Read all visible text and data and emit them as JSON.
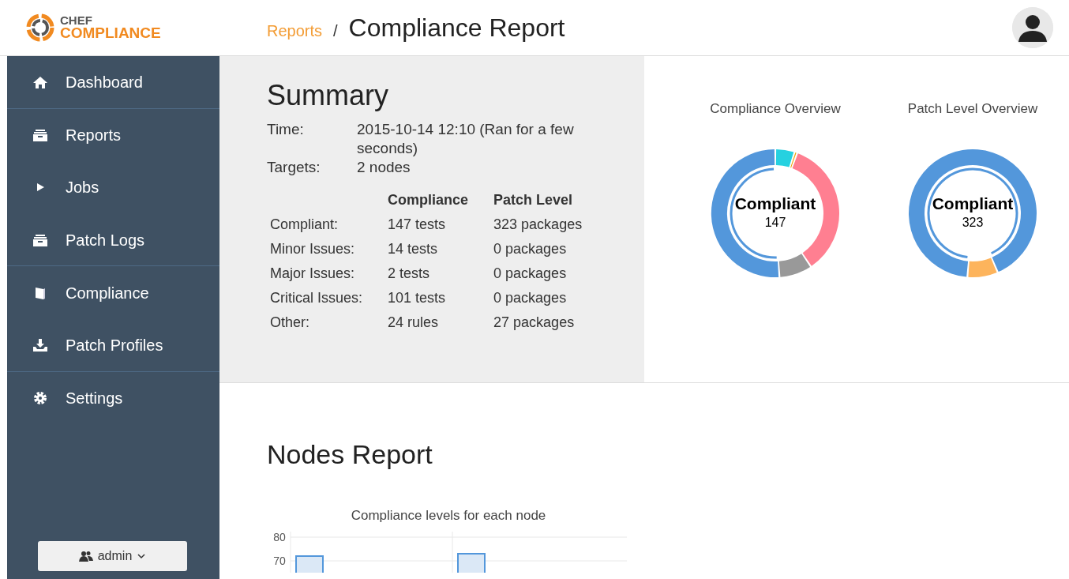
{
  "brand": {
    "top": "CHEF",
    "bottom": "COMPLIANCE"
  },
  "breadcrumb": {
    "parent": "Reports",
    "separator": "/",
    "current": "Compliance Report"
  },
  "sidebar": {
    "items": [
      {
        "label": "Dashboard"
      },
      {
        "label": "Reports"
      },
      {
        "label": "Jobs"
      },
      {
        "label": "Patch Logs"
      },
      {
        "label": "Compliance"
      },
      {
        "label": "Patch Profiles"
      },
      {
        "label": "Settings"
      }
    ],
    "user_button": "admin"
  },
  "summary": {
    "title": "Summary",
    "facts": [
      {
        "label": "Time:",
        "value": "2015-10-14 12:10 (Ran for a few seconds)"
      },
      {
        "label": "Targets:",
        "value": "2 nodes"
      }
    ],
    "columns": [
      "Compliance",
      "Patch Level"
    ],
    "rows": [
      {
        "label": "Compliant:",
        "compliance": "147 tests",
        "patch": "323 packages"
      },
      {
        "label": "Minor Issues:",
        "compliance": "14 tests",
        "patch": "0 packages"
      },
      {
        "label": "Major Issues:",
        "compliance": "2 tests",
        "patch": "0 packages"
      },
      {
        "label": "Critical Issues:",
        "compliance": "101 tests",
        "patch": "0 packages"
      },
      {
        "label": "Other:",
        "compliance": "24 rules",
        "patch": "27 packages"
      }
    ]
  },
  "overviews": [
    {
      "title": "Compliance Overview",
      "center_label": "Compliant",
      "center_value": "147",
      "chart_data": {
        "type": "donut",
        "series": [
          {
            "values": [
              51.04,
              4.86,
              0.69,
              35.07,
              8.34
            ]
          }
        ],
        "colors": [
          "#5397db",
          "#26d1e0",
          "#f0a30a",
          "#ff7f91",
          "#999999"
        ]
      }
    },
    {
      "title": "Patch Level Overview",
      "center_label": "Compliant",
      "center_value": "323",
      "chart_data": {
        "type": "donut",
        "series": [
          {
            "values": [
              92.29,
              7.71
            ]
          }
        ],
        "colors": [
          "#5397db",
          "#fdb45c"
        ]
      }
    }
  ],
  "nodes_report": {
    "title": "Nodes Report",
    "chart_title": "Compliance levels for each node",
    "y_tick_labels": [
      "80",
      "70"
    ]
  }
}
